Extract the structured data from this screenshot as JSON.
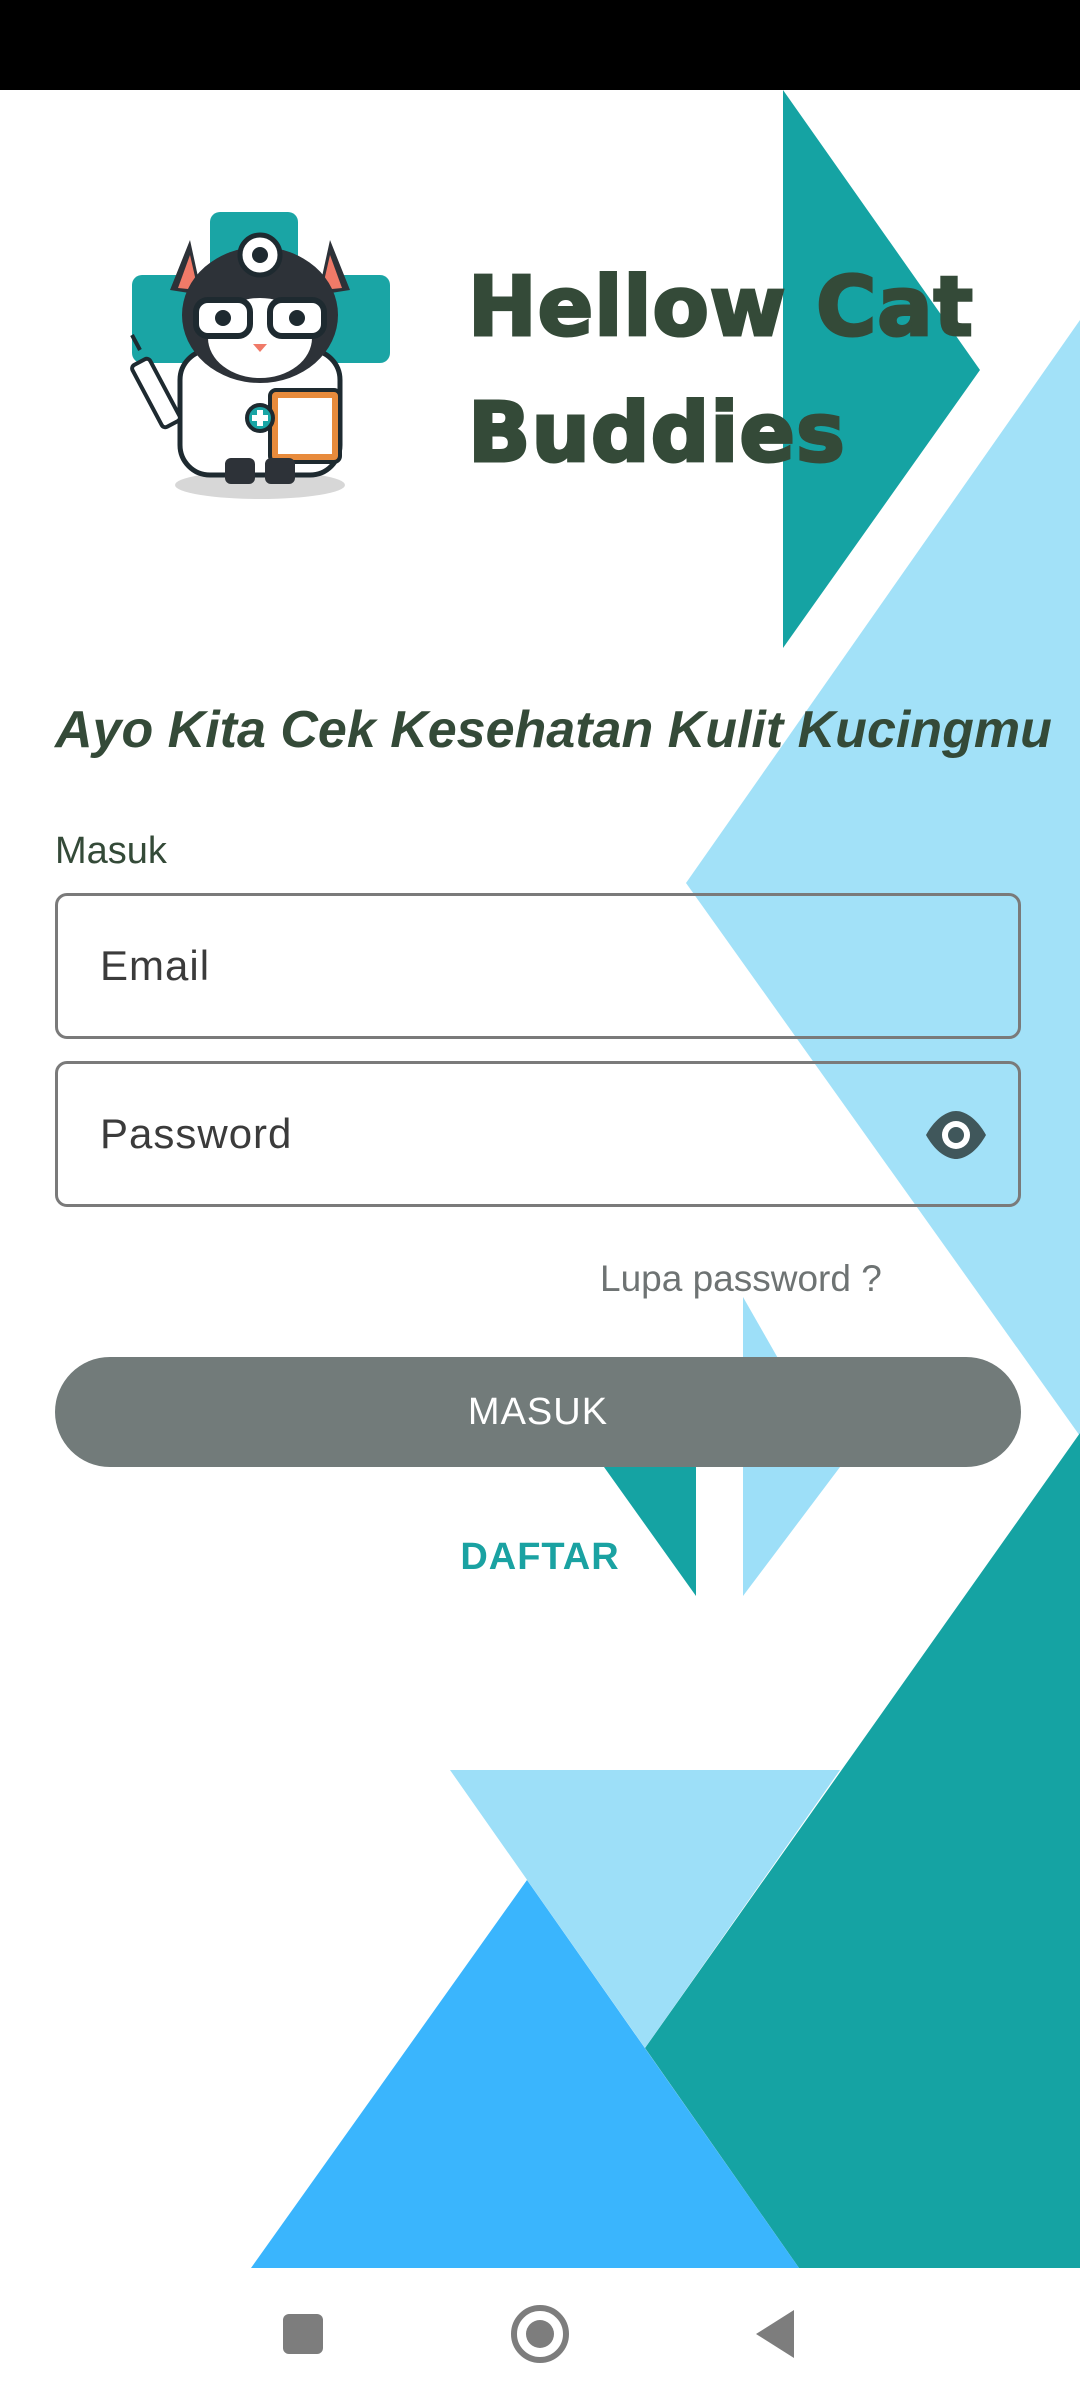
{
  "app": {
    "title": "Hellow Cat Buddies",
    "title_line1": "Hellow Cat",
    "title_line2": "Buddies",
    "tagline": "Ayo Kita Cek Kesehatan Kulit Kucingmu"
  },
  "login": {
    "section_label": "Masuk",
    "email_placeholder": "Email",
    "password_placeholder": "Password",
    "forgot_label": "Lupa password ?",
    "submit_label": "MASUK",
    "register_label": "DAFTAR"
  },
  "icons": {
    "logo": "doctor-cat-logo",
    "password_toggle": "eye-icon",
    "nav_recent": "square-icon",
    "nav_home": "circle-icon",
    "nav_back": "triangle-back-icon"
  },
  "colors": {
    "primary_text": "#344a38",
    "teal": "#15a3a3",
    "light_blue": "#9ddff8",
    "bright_blue": "#3ab5fd",
    "button": "#727b7a",
    "link": "#1aa2a2"
  }
}
